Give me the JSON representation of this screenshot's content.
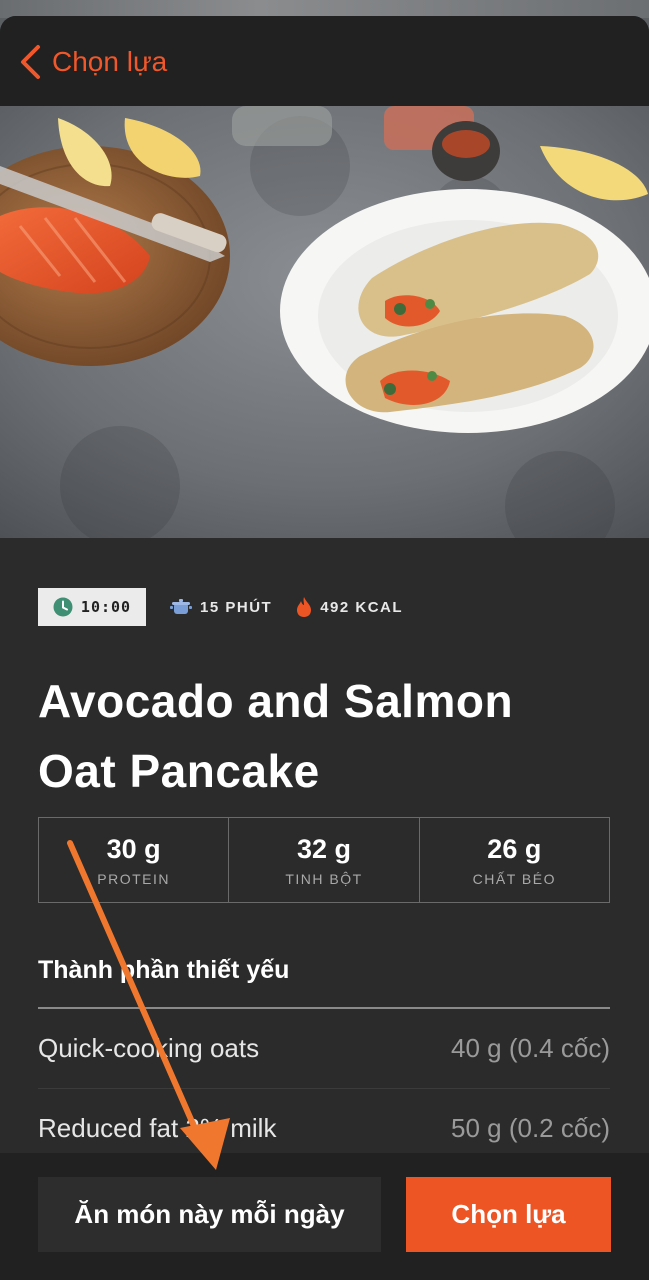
{
  "nav": {
    "back_label": "Chọn lựa"
  },
  "hero": {
    "image_alt": "Avocado and salmon oat pancake on a white plate"
  },
  "stats": {
    "time": "10:00",
    "duration": "15 PHÚT",
    "calories": "492 KCAL"
  },
  "recipe": {
    "title_line1": "Avocado and Salmon",
    "title_line2": "Oat Pancake"
  },
  "macros": [
    {
      "value": "30 g",
      "label": "PROTEIN"
    },
    {
      "value": "32 g",
      "label": "TINH BỘT"
    },
    {
      "value": "26 g",
      "label": "CHẤT BÉO"
    }
  ],
  "ingredients": {
    "title": "Thành phần thiết yếu",
    "items": [
      {
        "name": "Quick-cooking oats",
        "qty": "40 g (0.4 cốc)"
      },
      {
        "name": "Reduced fat 2% milk",
        "qty": "50 g (0.2 cốc)"
      }
    ]
  },
  "actions": {
    "eat_daily": "Ăn món này mỗi ngày",
    "choose": "Chọn lựa"
  },
  "colors": {
    "accent": "#ee5524",
    "background": "#2b2b2b",
    "bar": "#212121"
  }
}
